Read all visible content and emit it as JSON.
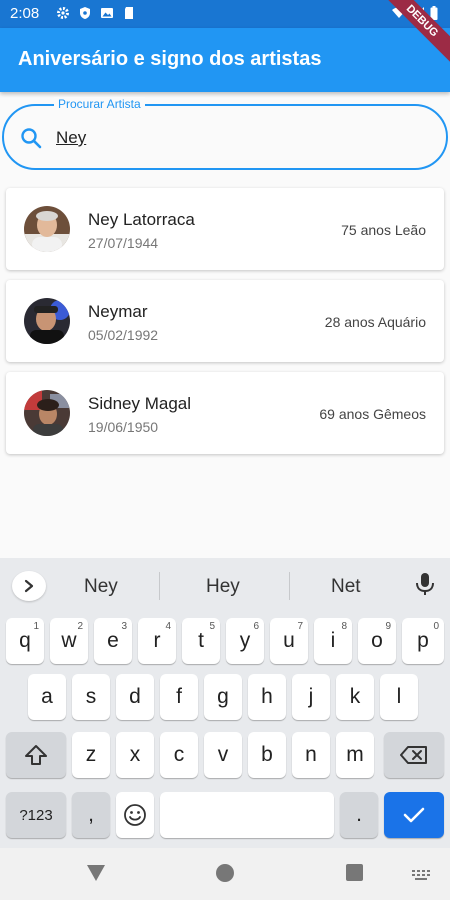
{
  "status_bar": {
    "time": "2:08",
    "debug_label": "DEBUG"
  },
  "app_bar": {
    "title": "Aniversário e signo dos artistas"
  },
  "search": {
    "label": "Procurar Artista",
    "value": "Ney"
  },
  "artists": [
    {
      "name": "Ney Latorraca",
      "birthdate": "27/07/1944",
      "info": "75 anos Leão"
    },
    {
      "name": "Neymar",
      "birthdate": "05/02/1992",
      "info": "28 anos Aquário"
    },
    {
      "name": "Sidney Magal",
      "birthdate": "19/06/1950",
      "info": "69 anos Gêmeos"
    }
  ],
  "keyboard": {
    "suggestions": [
      "Ney",
      "Hey",
      "Net"
    ],
    "row1": [
      {
        "k": "q",
        "h": "1"
      },
      {
        "k": "w",
        "h": "2"
      },
      {
        "k": "e",
        "h": "3"
      },
      {
        "k": "r",
        "h": "4"
      },
      {
        "k": "t",
        "h": "5"
      },
      {
        "k": "y",
        "h": "6"
      },
      {
        "k": "u",
        "h": "7"
      },
      {
        "k": "i",
        "h": "8"
      },
      {
        "k": "o",
        "h": "9"
      },
      {
        "k": "p",
        "h": "0"
      }
    ],
    "row2": [
      "a",
      "s",
      "d",
      "f",
      "g",
      "h",
      "j",
      "k",
      "l"
    ],
    "row3": [
      "z",
      "x",
      "c",
      "v",
      "b",
      "n",
      "m"
    ],
    "symbols_label": "?123",
    "comma_label": ",",
    "period_label": "."
  },
  "colors": {
    "primary": "#2196f3",
    "status_bar": "#1976d2",
    "action_key": "#1a73e8"
  }
}
